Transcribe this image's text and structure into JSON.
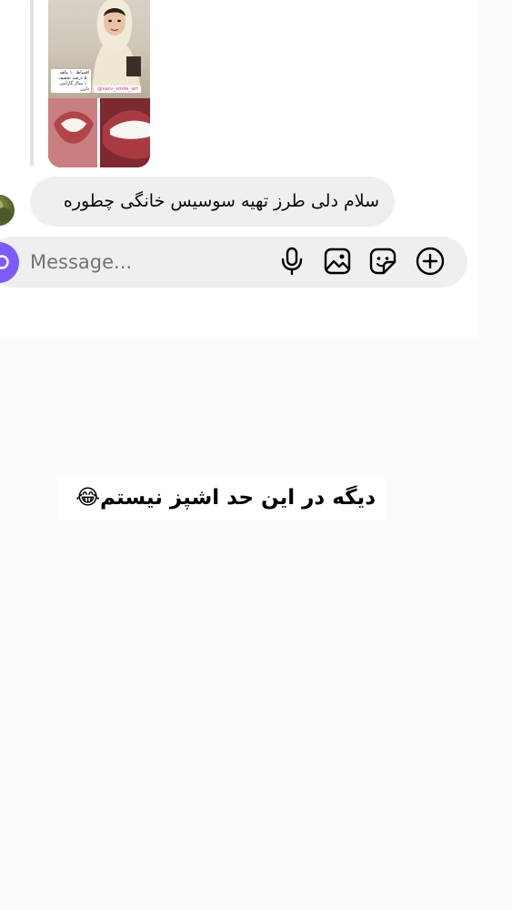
{
  "thread": {
    "shared_post": {
      "caption_lines": [
        "اقساط ۱۰ ماهه",
        "۵۰ درصد تخفیف",
        "۱۰ سال گارانتی",
        "دارن"
      ],
      "tag": "@sarv_smile_art"
    },
    "received_message": {
      "text": "سلام دلی طرز تهیه سوسیس خانگی چطوره"
    }
  },
  "composer": {
    "placeholder": "Message...",
    "icons": [
      "camera-icon",
      "microphone-icon",
      "image-icon",
      "sticker-icon",
      "plus-circle-icon"
    ]
  },
  "overlay": {
    "caption": "دیگه در این حد اشپز نیستم😂"
  },
  "colors": {
    "bubble": "#efefef",
    "camera_accent": "#7d5cff",
    "placeholder": "#737373",
    "text": "#0a0a0a"
  }
}
